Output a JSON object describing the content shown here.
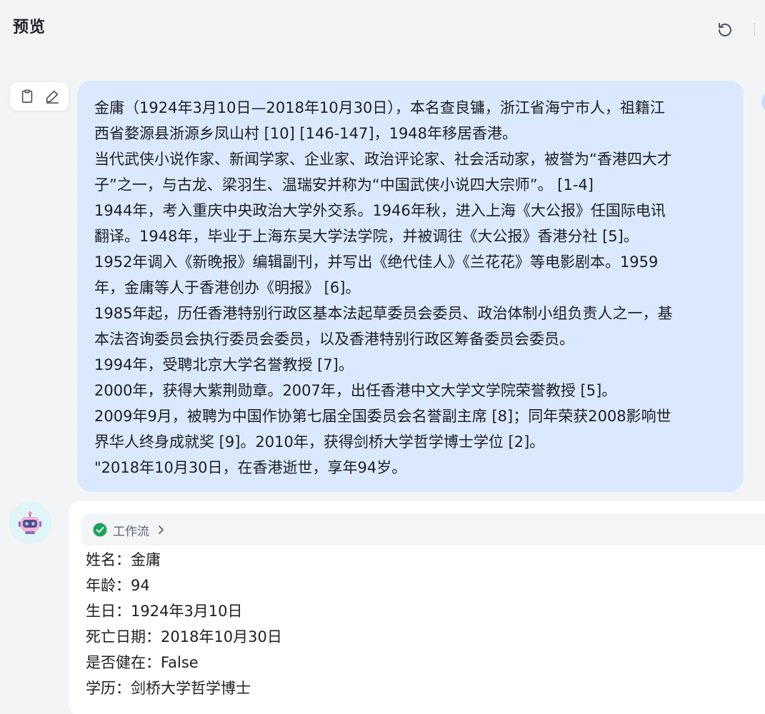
{
  "header": {
    "title": "预览"
  },
  "user_message": {
    "lines": [
      "金庸（1924年3月10日—2018年10月30日），本名查良镛，浙江省海宁市人，祖籍江",
      "西省婺源县浙源乡凤山村 [10] [146-147]，1948年移居香港。",
      "当代武侠小说作家、新闻学家、企业家、政治评论家、社会活动家，被誉为“香港四大才",
      "子”之一，与古龙、梁羽生、温瑞安并称为“中国武侠小说四大宗师”。 [1-4]",
      "1944年，考入重庆中央政治大学外交系。1946年秋，进入上海《大公报》任国际电讯",
      "翻译。1948年，毕业于上海东吴大学法学院，并被调往《大公报》香港分社 [5]。",
      "1952年调入《新晚报》编辑副刊，并写出《绝代佳人》《兰花花》等电影剧本。1959",
      "年，金庸等人于香港创办《明报》 [6]。",
      "1985年起，历任香港特别行政区基本法起草委员会委员、政治体制小组负责人之一，基",
      "本法咨询委员会执行委员会委员，以及香港特别行政区筹备委员会委员。",
      "1994年，受聘北京大学名誉教授 [7]。",
      "2000年，获得大紫荆勋章。2007年，出任香港中文大学文学院荣誉教授 [5]。",
      "2009年9月，被聘为中国作协第七届全国委员会名誉副主席 [8]；同年荣获2008影响世",
      "界华人终身成就奖 [9]。2010年，获得剑桥大学哲学博士学位 [2]。",
      "\"2018年10月30日，在香港逝世，享年94岁。"
    ]
  },
  "bot_message": {
    "workflow_label": "工作流",
    "lines": [
      "姓名：金庸",
      "年龄：94",
      "生日：1924年3月10日",
      "死亡日期：2018年10月30日",
      "是否健在：False",
      "学历：剑桥大学哲学博士"
    ]
  },
  "icons": {
    "refresh": "refresh-icon",
    "copy": "clipboard-icon",
    "edit": "pencil-icon",
    "status": "check-circle-icon",
    "chevron": "chevron-right-icon",
    "bot": "robot-avatar-icon"
  },
  "colors": {
    "user_bubble": "#dbe9fe",
    "success": "#1aa55b",
    "bot_avatar_bg": "#dff5f7",
    "background": "#f3f4f6"
  }
}
